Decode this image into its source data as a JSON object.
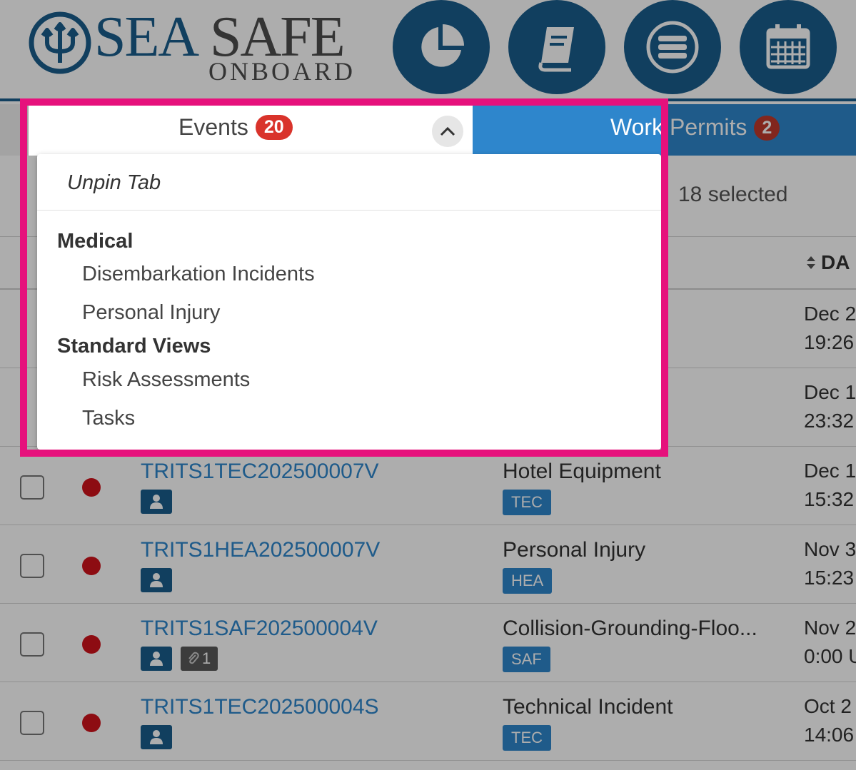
{
  "app": {
    "logo": {
      "part1": "SEA",
      "part2": "SAFE",
      "part3": "ONBOARD"
    },
    "nav_icons": [
      "chart-icon",
      "book-icon",
      "menu-icon",
      "calendar-icon"
    ]
  },
  "tabs": {
    "events": {
      "label": "Events",
      "count": "20"
    },
    "work_permits": {
      "label": "Work Permits",
      "count": "2"
    }
  },
  "toolbar": {
    "selected_text": "18 selected"
  },
  "table": {
    "date_header": "DA",
    "rows": [
      {
        "ref": "TRITS1TEC202500007V",
        "type": "Hotel Equipment",
        "tag": "TEC",
        "date": "Dec 1",
        "time": "15:32",
        "attachments": ""
      },
      {
        "ref": "TRITS1HEA202500007V",
        "type": "Personal Injury",
        "tag": "HEA",
        "date": "Nov 3",
        "time": "15:23",
        "attachments": ""
      },
      {
        "ref": "TRITS1SAF202500004V",
        "type": "Collision-Grounding-Floo...",
        "tag": "SAF",
        "date": "Nov 2",
        "time": "0:00 U",
        "attachments": "1"
      },
      {
        "ref": "TRITS1TEC202500004S",
        "type": "Technical Incident",
        "tag": "TEC",
        "date": "Oct 2",
        "time": "14:06",
        "attachments": ""
      }
    ],
    "partial_rows": [
      {
        "date": "Dec 2",
        "time": "19:26"
      },
      {
        "date": "Dec 1",
        "time": "23:32"
      }
    ]
  },
  "menu": {
    "unpin": "Unpin Tab",
    "groups": [
      {
        "name": "Medical",
        "items": [
          "Disembarkation Incidents",
          "Personal Injury"
        ]
      },
      {
        "name": "Standard Views",
        "items": [
          "Risk Assessments",
          "Tasks"
        ]
      }
    ]
  },
  "colors": {
    "brand_blue": "#1a5d8c",
    "tab_blue": "#2e86cc",
    "badge_red": "#d9332b",
    "status_red": "#d0121b",
    "highlight_pink": "#e6117c"
  }
}
